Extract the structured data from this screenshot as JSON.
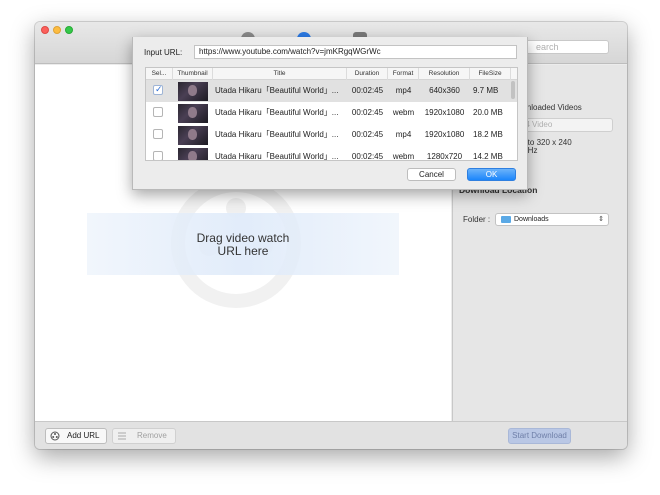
{
  "window": {
    "search_placeholder": "earch"
  },
  "main": {
    "drop_line1": "Drag video watch",
    "drop_line2": "URL here"
  },
  "right_panel": {
    "downloaded_videos_label": "wnloaded Videos",
    "format_field_text": "P4 Video",
    "resolution_line1": "p to 320 x 240",
    "resolution_line2": "0 Hz",
    "download_location_heading": "Download Location",
    "folder_label": "Folder :",
    "folder_value": "Downloads"
  },
  "bottom_bar": {
    "add_url_label": "Add URL",
    "remove_label": "Remove",
    "start_download_label": "Start Download"
  },
  "dialog": {
    "input_url_label": "Input URL:",
    "input_url_value": "https://www.youtube.com/watch?v=jmKRgqWGrWc",
    "columns": [
      "Sel...",
      "Thumbnail",
      "Title",
      "Duration",
      "Format",
      "Resolution",
      "FileSize"
    ],
    "rows": [
      {
        "selected": true,
        "title": "Utada Hikaru「Beautiful World」...",
        "duration": "00:02:45",
        "format": "mp4",
        "resolution": "640x360",
        "filesize": "9.7 MB"
      },
      {
        "selected": false,
        "title": "Utada Hikaru「Beautiful World」...",
        "duration": "00:02:45",
        "format": "webm",
        "resolution": "1920x1080",
        "filesize": "20.0 MB"
      },
      {
        "selected": false,
        "title": "Utada Hikaru「Beautiful World」...",
        "duration": "00:02:45",
        "format": "mp4",
        "resolution": "1920x1080",
        "filesize": "18.2 MB"
      },
      {
        "selected": false,
        "title": "Utada Hikaru「Beautiful World」...",
        "duration": "00:02:45",
        "format": "webm",
        "resolution": "1280x720",
        "filesize": "14.2 MB"
      }
    ],
    "cancel_label": "Cancel",
    "ok_label": "OK"
  },
  "colors": {
    "accent": "#1b86fb",
    "checkmark": "#2f6fd6",
    "folder": "#5aa9e6"
  }
}
